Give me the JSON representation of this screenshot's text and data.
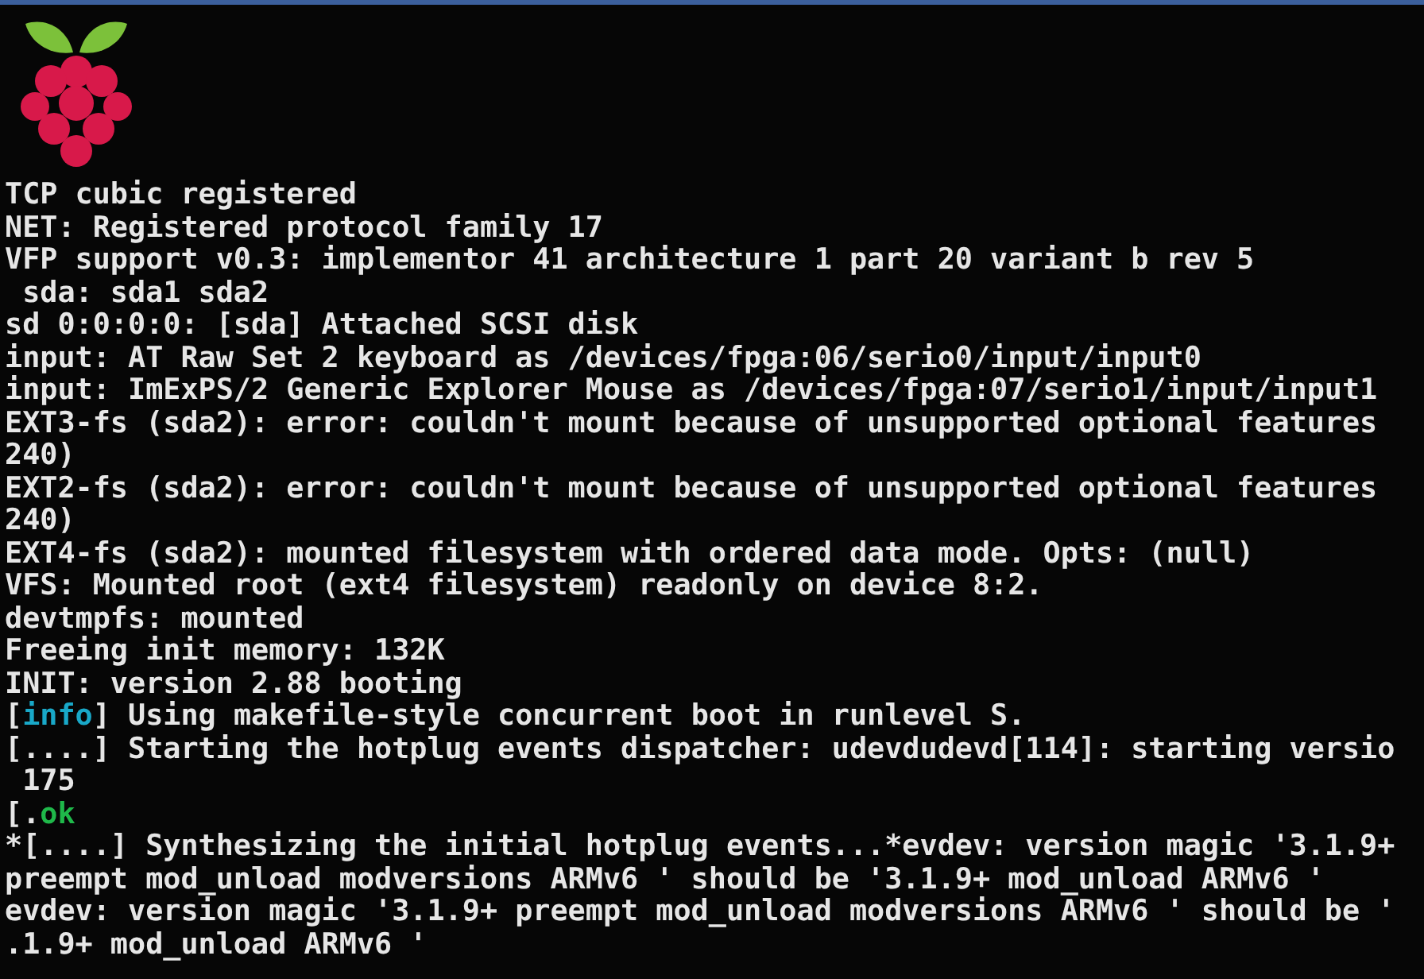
{
  "console": {
    "lines": [
      {
        "segments": [
          {
            "text": "TCP cubic registered"
          }
        ]
      },
      {
        "segments": [
          {
            "text": "NET: Registered protocol family 17"
          }
        ]
      },
      {
        "segments": [
          {
            "text": "VFP support v0.3: implementor 41 architecture 1 part 20 variant b rev 5"
          }
        ]
      },
      {
        "segments": [
          {
            "text": " sda: sda1 sda2"
          }
        ]
      },
      {
        "segments": [
          {
            "text": "sd 0:0:0:0: [sda] Attached SCSI disk"
          }
        ]
      },
      {
        "segments": [
          {
            "text": "input: AT Raw Set 2 keyboard as /devices/fpga:06/serio0/input/input0"
          }
        ]
      },
      {
        "segments": [
          {
            "text": "input: ImExPS/2 Generic Explorer Mouse as /devices/fpga:07/serio1/input/input1"
          }
        ]
      },
      {
        "segments": [
          {
            "text": "EXT3-fs (sda2): error: couldn't mount because of unsupported optional features"
          }
        ]
      },
      {
        "segments": [
          {
            "text": "240)"
          }
        ]
      },
      {
        "segments": [
          {
            "text": "EXT2-fs (sda2): error: couldn't mount because of unsupported optional features"
          }
        ]
      },
      {
        "segments": [
          {
            "text": "240)"
          }
        ]
      },
      {
        "segments": [
          {
            "text": "EXT4-fs (sda2): mounted filesystem with ordered data mode. Opts: (null)"
          }
        ]
      },
      {
        "segments": [
          {
            "text": "VFS: Mounted root (ext4 filesystem) readonly on device 8:2."
          }
        ]
      },
      {
        "segments": [
          {
            "text": "devtmpfs: mounted"
          }
        ]
      },
      {
        "segments": [
          {
            "text": "Freeing init memory: 132K"
          }
        ]
      },
      {
        "segments": [
          {
            "text": "INIT: version 2.88 booting"
          }
        ]
      },
      {
        "segments": [
          {
            "text": "["
          },
          {
            "text": "info",
            "color": "#19a8c8"
          },
          {
            "text": "] Using makefile-style concurrent boot in runlevel S."
          }
        ]
      },
      {
        "segments": [
          {
            "text": "[....] Starting the hotplug events dispatcher: udevdudevd[114]: starting versio"
          }
        ]
      },
      {
        "segments": [
          {
            "text": " 175"
          }
        ]
      },
      {
        "segments": [
          {
            "text": "[."
          },
          {
            "text": "ok",
            "color": "#1fb84a"
          }
        ]
      },
      {
        "segments": [
          {
            "text": "*[....] Synthesizing the initial hotplug events...*evdev: version magic '3.1.9+"
          }
        ]
      },
      {
        "segments": [
          {
            "text": "preempt mod_unload modversions ARMv6 ' should be '3.1.9+ mod_unload ARMv6 '"
          }
        ]
      },
      {
        "segments": [
          {
            "text": "evdev: version magic '3.1.9+ preempt mod_unload modversions ARMv6 ' should be '"
          }
        ]
      },
      {
        "segments": [
          {
            "text": ".1.9+ mod_unload ARMv6 '"
          }
        ]
      }
    ]
  }
}
